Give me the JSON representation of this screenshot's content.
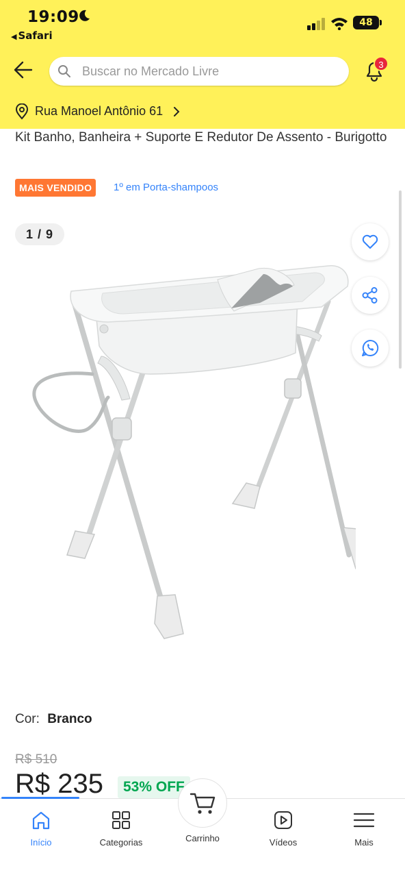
{
  "status_bar": {
    "time": "19:09",
    "back_app": "Safari",
    "battery": "48"
  },
  "header": {
    "search_placeholder": "Buscar no Mercado Livre",
    "notifications_count": "3",
    "address": "Rua Manoel Antônio 61"
  },
  "product": {
    "title": "Kit Banho, Banheira + Suporte E Redutor De Assento - Burigotto",
    "best_seller_badge": "MAIS VENDIDO",
    "ranking": "1º em Porta-shampoos",
    "image_counter": "1 / 9",
    "color_label": "Cor:",
    "color_value": "Branco",
    "old_price": "R$ 510",
    "price": "R$ 235",
    "discount": "53% OFF"
  },
  "tabbar": {
    "items": [
      {
        "label": "Início",
        "icon": "home-icon",
        "active": true
      },
      {
        "label": "Categorias",
        "icon": "grid-icon",
        "active": false
      },
      {
        "label": "Carrinho",
        "icon": "cart-icon",
        "active": false
      },
      {
        "label": "Vídeos",
        "icon": "play-icon",
        "active": false
      },
      {
        "label": "Mais",
        "icon": "menu-icon",
        "active": false
      }
    ]
  },
  "colors": {
    "header_yellow": "#fff159",
    "accent_blue": "#3483fa",
    "badge_orange": "#ff7733",
    "discount_green": "#00a650"
  }
}
